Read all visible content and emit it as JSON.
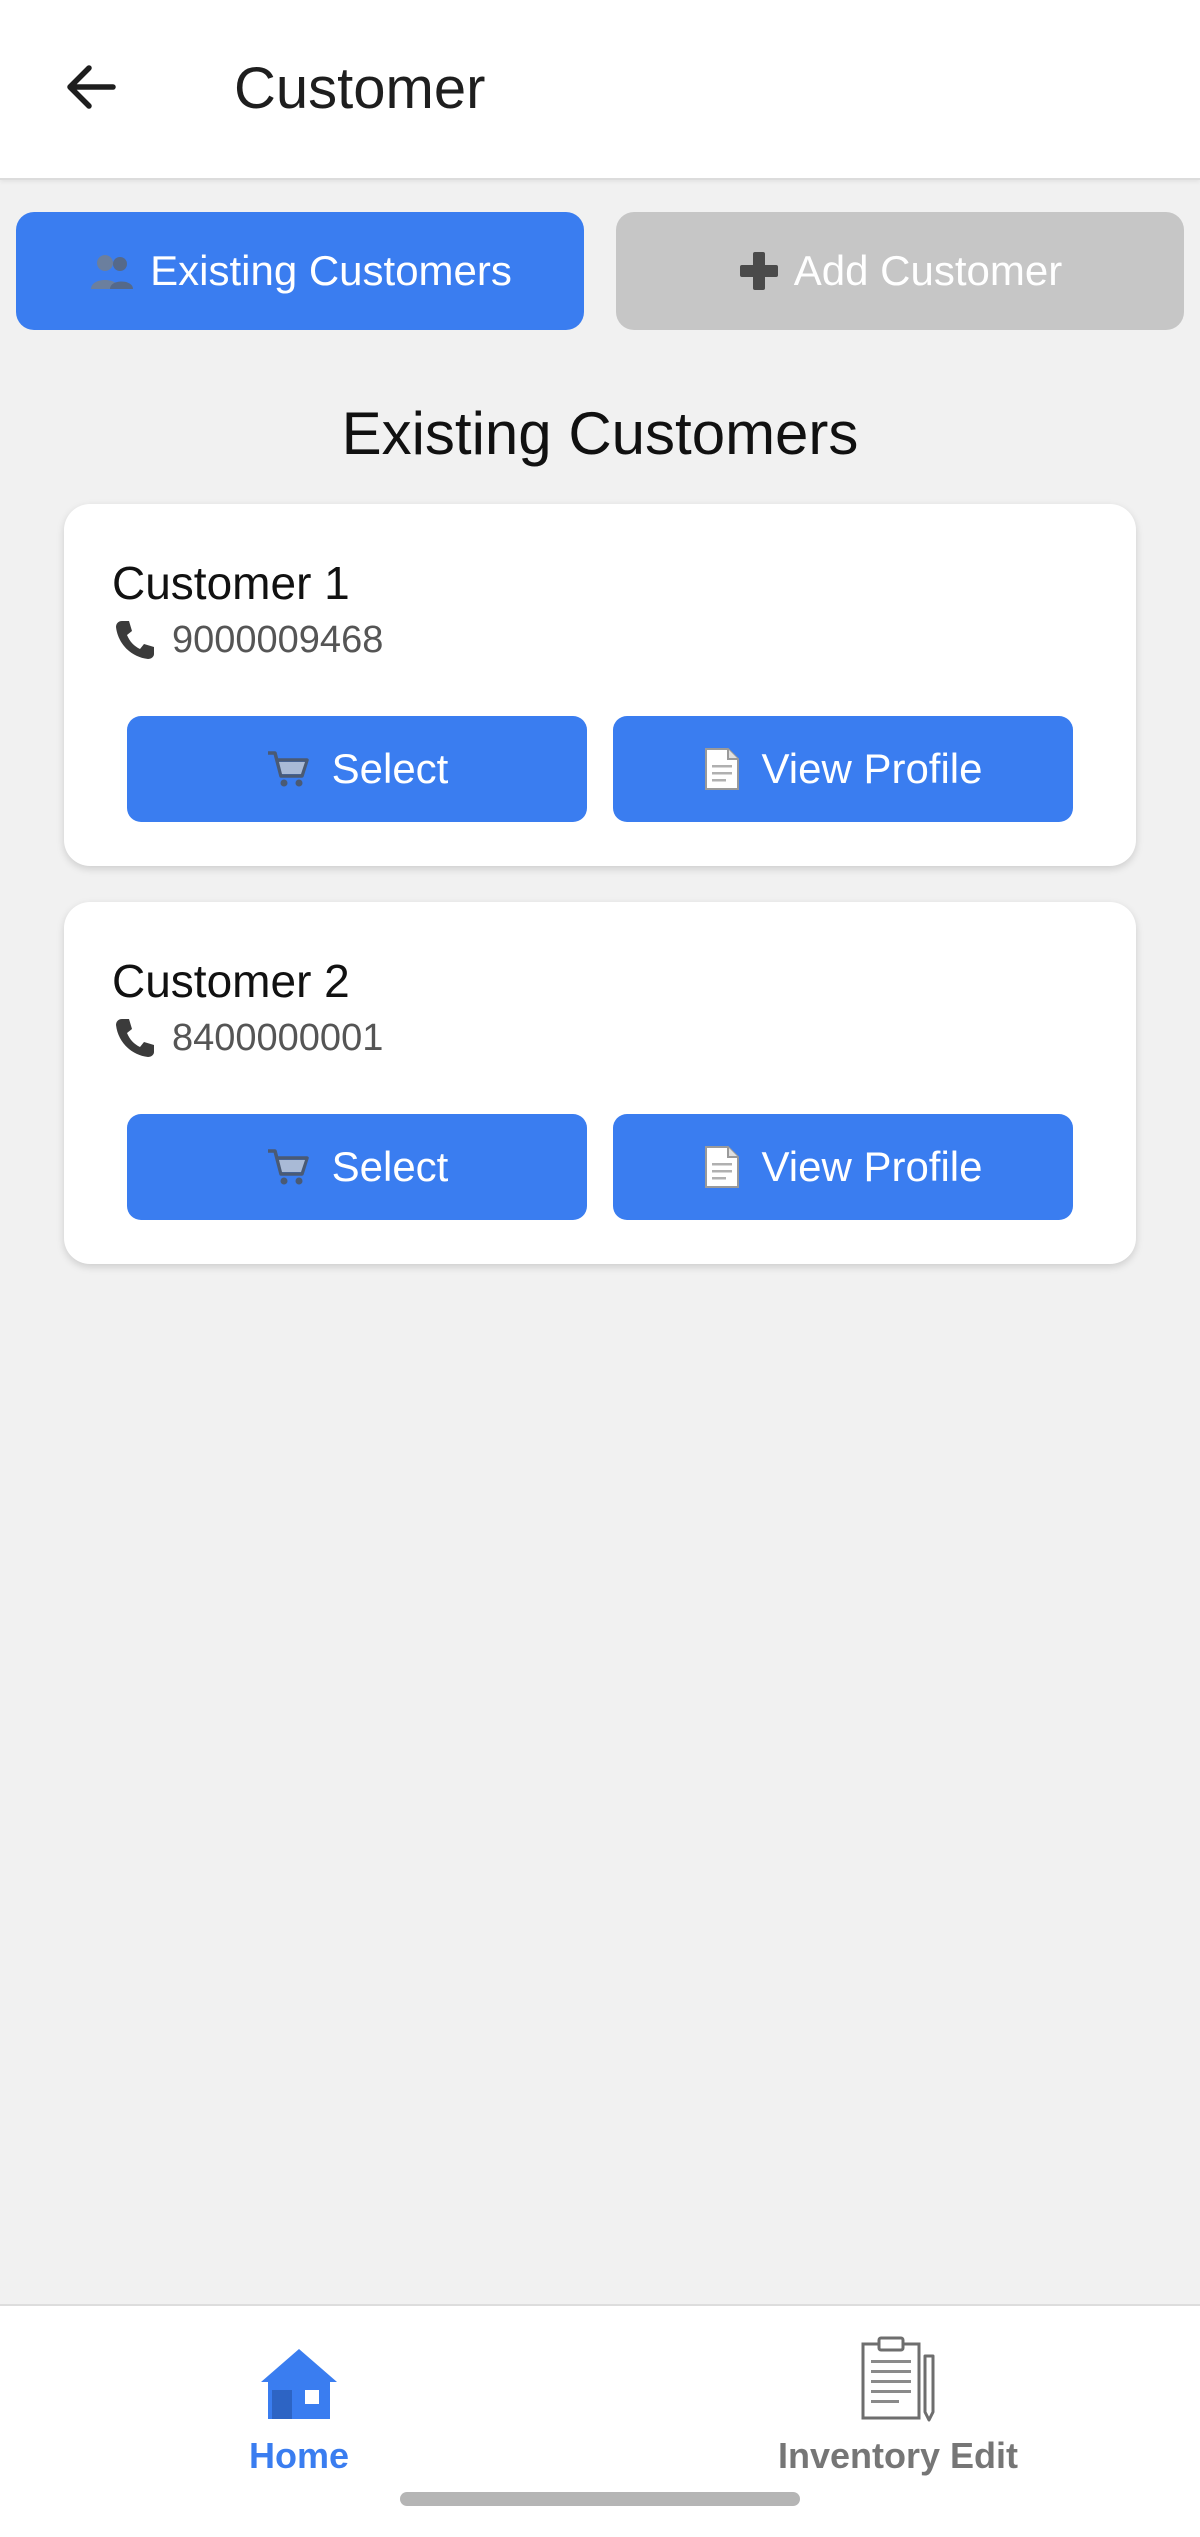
{
  "header": {
    "title": "Customer",
    "back_icon": "arrow-left-icon"
  },
  "tabs": [
    {
      "label": "Existing Customers",
      "icon": "people-icon",
      "active": true
    },
    {
      "label": "Add Customer",
      "icon": "plus-icon",
      "active": false
    }
  ],
  "section": {
    "title": "Existing Customers"
  },
  "customers": [
    {
      "name": "Customer 1",
      "phone": "9000009468",
      "select_label": "Select",
      "view_label": "View Profile"
    },
    {
      "name": "Customer 2",
      "phone": "8400000001",
      "select_label": "Select",
      "view_label": "View Profile"
    }
  ],
  "bottom_nav": {
    "items": [
      {
        "label": "Home",
        "icon": "home-icon",
        "active": true
      },
      {
        "label": "Inventory Edit",
        "icon": "clipboard-icon",
        "active": false
      }
    ]
  },
  "colors": {
    "accent": "#3a7df0",
    "inactive_tab": "#c6c6c6",
    "background": "#f1f1f1",
    "nav_inactive": "#767676"
  }
}
